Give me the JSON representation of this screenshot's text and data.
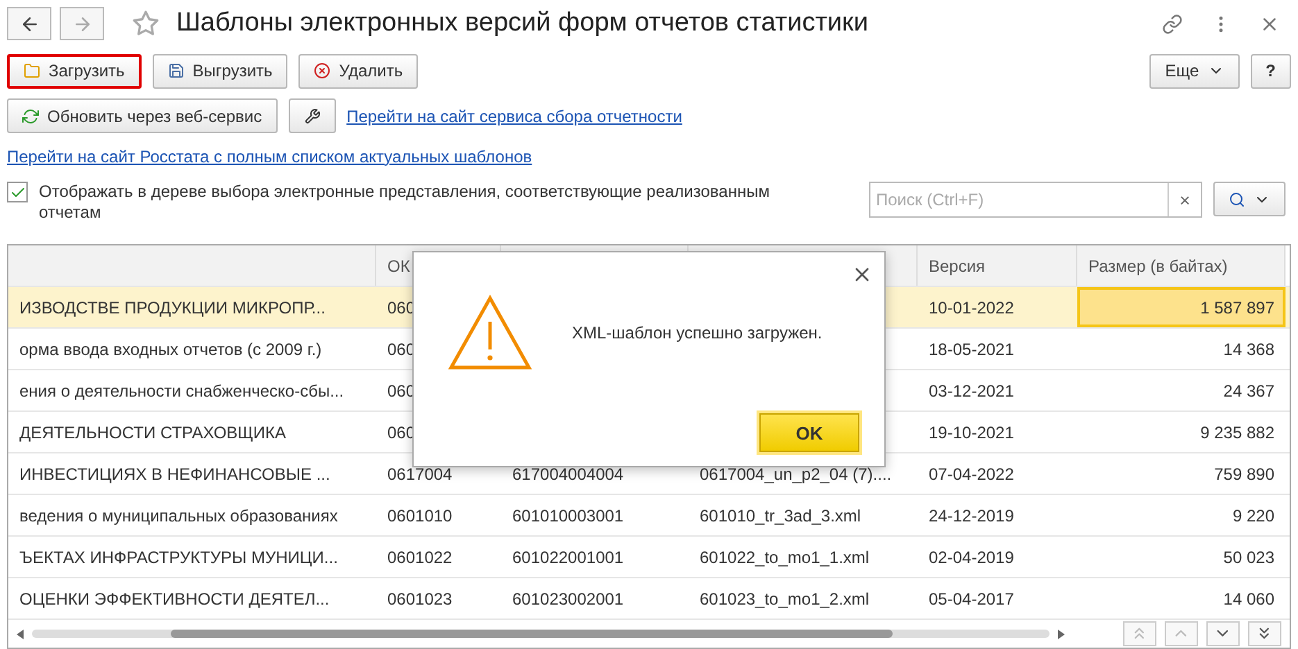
{
  "window": {
    "title": "Шаблоны электронных версий форм отчетов статистики"
  },
  "toolbar": [
    {
      "kind": "upload",
      "label": "Загрузить",
      "selected": true
    },
    {
      "kind": "save",
      "label": "Выгрузить",
      "selected": false
    },
    {
      "kind": "delete",
      "label": "Удалить",
      "selected": false
    }
  ],
  "more_button": "Еще",
  "help_button": "?",
  "refresh_button": "Обновить через веб-сервис",
  "service_link": "Перейти на сайт сервиса сбора отчетности",
  "rosstat_link": "Перейти на сайт Росстата с полным списком актуальных шаблонов",
  "filter": {
    "label": "Отображать в дереве выбора электронные представления, соответствующие реализованным отчетам",
    "checked": true
  },
  "search": {
    "placeholder": "Поиск (Ctrl+F)",
    "clear": "×"
  },
  "table": {
    "columns": [
      "",
      "ОК",
      "",
      "",
      "Версия",
      "Размер (в байтах)"
    ],
    "rows": [
      {
        "selected": true,
        "cells": [
          "ИЗВОДСТВЕ ПРОДУКЦИИ МИКРОПР...",
          "060",
          "",
          "",
          "10-01-2022",
          "1 587 897"
        ]
      },
      {
        "selected": false,
        "cells": [
          "орма ввода входных отчетов (с 2009 г.)",
          "060",
          "",
          "",
          "18-05-2021",
          "14 368"
        ]
      },
      {
        "selected": false,
        "cells": [
          "ения о деятельности снабженческо-сбы...",
          "060",
          "",
          "",
          "03-12-2021",
          "24 367"
        ]
      },
      {
        "selected": false,
        "cells": [
          "ДЕЯТЕЛЬНОСТИ СТРАХОВЩИКА",
          "060",
          "",
          "",
          "19-10-2021",
          "9 235 882"
        ]
      },
      {
        "selected": false,
        "cells": [
          "ИНВЕСТИЦИЯХ В НЕФИНАНСОВЫЕ ...",
          "0617004",
          "617004004004",
          "0617004_un_p2_04 (7)....",
          "07-04-2022",
          "759 890"
        ]
      },
      {
        "selected": false,
        "cells": [
          "ведения о муниципальных образованиях",
          "0601010",
          "601010003001",
          "601010_tr_3ad_3.xml",
          "24-12-2019",
          "9 220"
        ]
      },
      {
        "selected": false,
        "cells": [
          "ЪЕКТАХ ИНФРАСТРУКТУРЫ МУНИЦИ...",
          "0601022",
          "601022001001",
          "601022_to_mo1_1.xml",
          "02-04-2019",
          "50 023"
        ]
      },
      {
        "selected": false,
        "cells": [
          "ОЦЕНКИ ЭФФЕКТИВНОСТИ ДЕЯТЕЛ...",
          "0601023",
          "601023002001",
          "601023_to_mo1_2.xml",
          "05-04-2017",
          "14 060"
        ]
      }
    ]
  },
  "dialog": {
    "message": "XML-шаблон успешно загружен.",
    "button": "OK"
  }
}
